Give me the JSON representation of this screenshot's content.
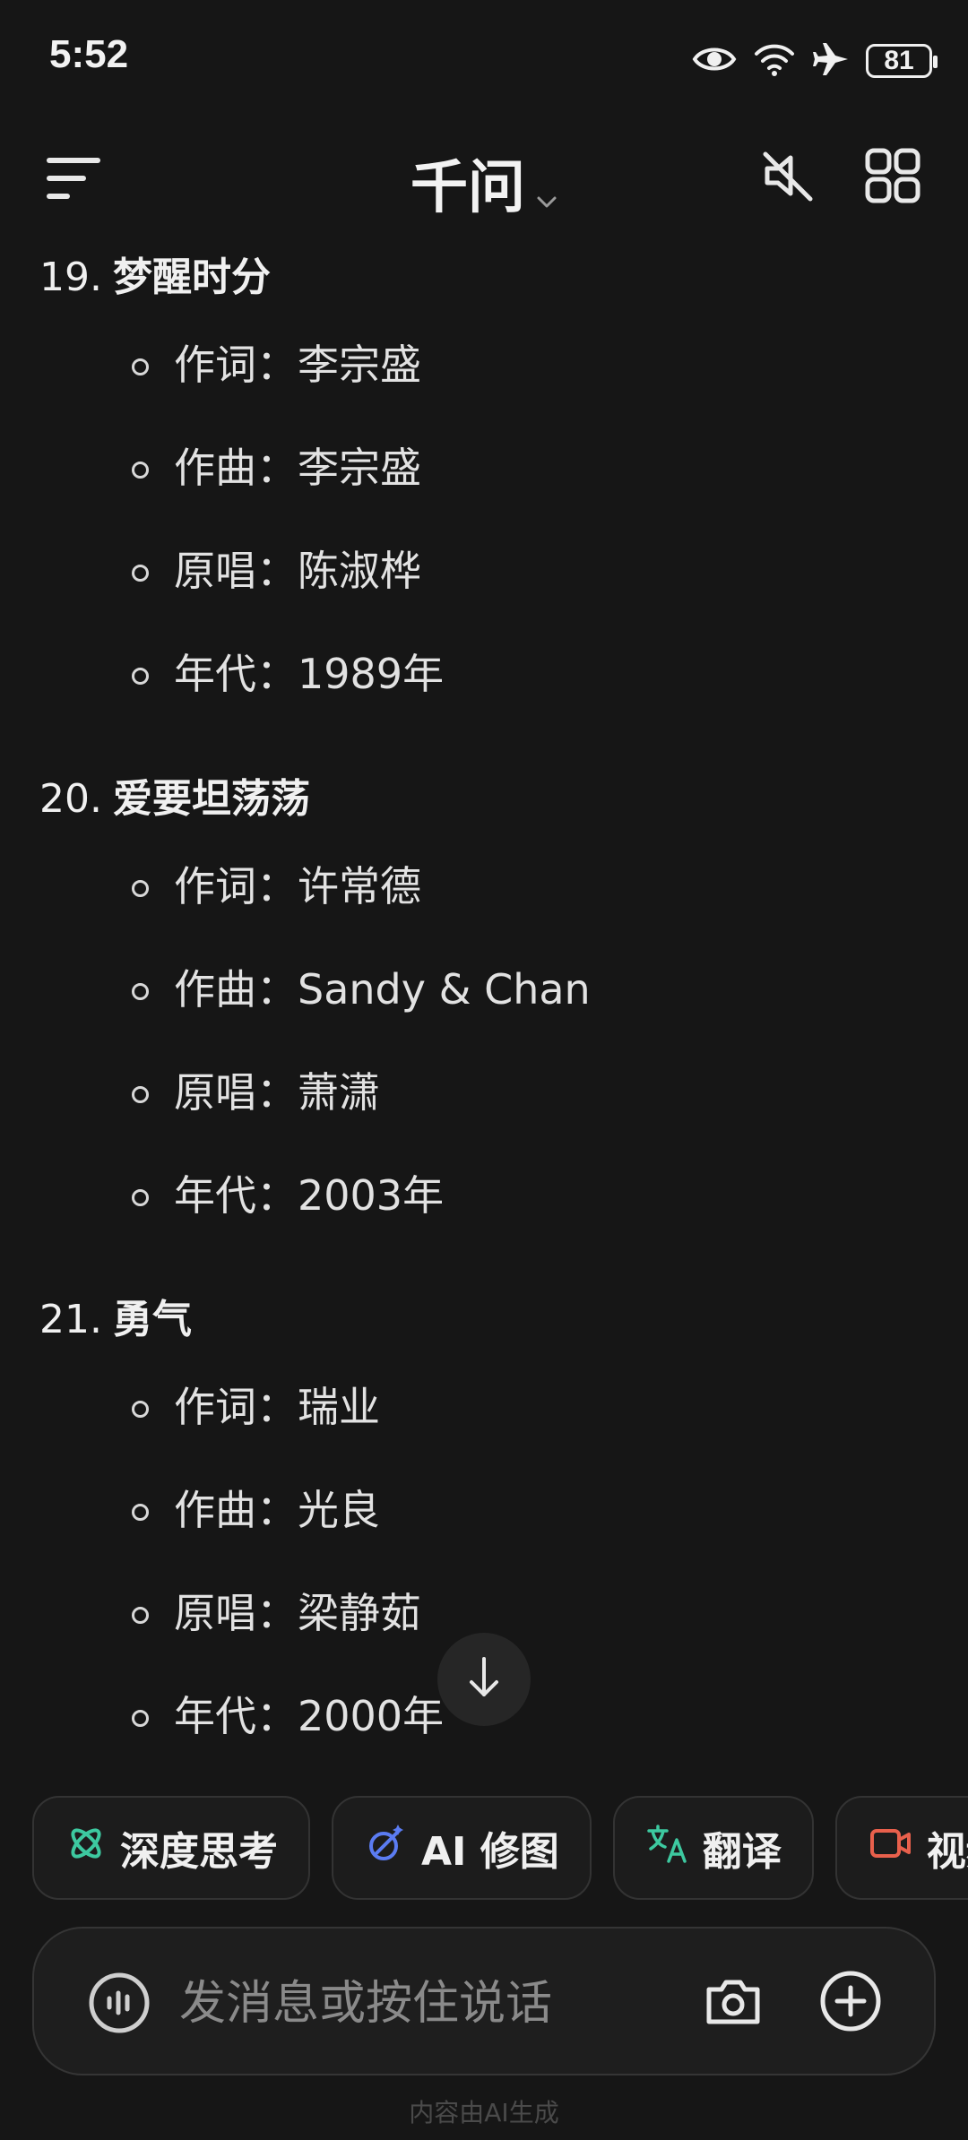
{
  "status_bar": {
    "time": "5:52",
    "battery": "81",
    "icons": [
      "eye-icon",
      "wifi-icon",
      "airplane-icon",
      "battery-icon"
    ]
  },
  "header": {
    "title": "千问",
    "icons": [
      "menu-icon",
      "chevron-down-icon",
      "mute-icon",
      "grid-icon"
    ]
  },
  "songs": [
    {
      "number": "19.",
      "title": "梦醒时分",
      "details": [
        "作词：李宗盛",
        "作曲：李宗盛",
        "原唱：陈淑桦",
        "年代：1989年"
      ]
    },
    {
      "number": "20.",
      "title": "爱要坦荡荡",
      "details": [
        "作词：许常德",
        "作曲：Sandy & Chan",
        "原唱：萧潇",
        "年代：2003年"
      ]
    },
    {
      "number": "21.",
      "title": "勇气",
      "details": [
        "作词：瑞业",
        "作曲：光良",
        "原唱：梁静茹",
        "年代：2000年"
      ]
    }
  ],
  "chips": [
    {
      "label": "深度思考",
      "icon": "atom-icon",
      "color": "#3dc9a0"
    },
    {
      "label": "AI 修图",
      "icon": "magic-wand-icon",
      "color": "#5b7cf2"
    },
    {
      "label": "翻译",
      "icon": "translate-icon",
      "color": "#3dc9a0"
    },
    {
      "label": "视频",
      "icon": "video-icon",
      "color": "#e8604c"
    }
  ],
  "input": {
    "placeholder": "发消息或按住说话",
    "value": ""
  },
  "footnote": "内容由AI生成"
}
